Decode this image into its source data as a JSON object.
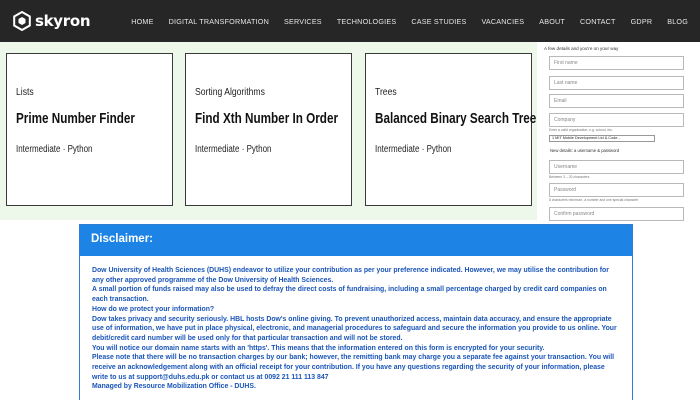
{
  "brand": {
    "name": "skyron",
    "logo_icon": "skyron-logo-icon"
  },
  "nav": {
    "items": [
      "HOME",
      "DIGITAL TRANSFORMATION",
      "SERVICES",
      "TECHNOLOGIES",
      "CASE STUDIES",
      "VACANCIES",
      "ABOUT",
      "CONTACT",
      "GDPR",
      "BLOG"
    ]
  },
  "cards": [
    {
      "category": "Lists",
      "title": "Prime Number Finder",
      "meta": "Intermediate · Python"
    },
    {
      "category": "Sorting Algorithms",
      "title": "Find Xth Number In Order",
      "meta": "Intermediate · Python"
    },
    {
      "category": "Trees",
      "title": "Balanced Binary Search Tree",
      "meta": "Intermediate · Python"
    }
  ],
  "form": {
    "heading": "A few details and you're on your way",
    "first_name_placeholder": "First name",
    "last_name_placeholder": "Last name",
    "email_placeholder": "Email",
    "company_placeholder": "Company",
    "company_hint": "Enter a valid organisation, e.g. school, etc.",
    "company_type_value": "1 MIT Mobile Development Ltd & Code...",
    "new_credentials_heading": "New details: a username & password",
    "username_placeholder": "Username",
    "username_hint": "Between 3 – 20 characters",
    "password_placeholder": "Password",
    "password_hint": "8 characters minimum, a number and one special character",
    "confirm_password_placeholder": "Confirm password"
  },
  "disclaimer": {
    "title": "Disclaimer:",
    "lines": [
      "Dow University of Health Sciences (DUHS) endeavor to utilize your contribution as per your preference indicated. However, we may utilise the contribution for any other approved programme of the Dow University of Health Sciences.",
      "A small portion of funds raised may also be used to defray the direct costs of fundraising, including a small percentage charged by credit card companies on each transaction.",
      "How do we protect your information?",
      "Dow takes privacy and security seriously. HBL hosts Dow's online giving. To prevent unauthorized access, maintain data accuracy, and ensure the appropriate use of information, we have put in place physical, electronic, and managerial procedures to safeguard and secure the information you provide to us online. Your debit/credit card number will be used only for that particular transaction and will not be stored.",
      "You will notice our domain name starts with an 'https'. This means that the information entered on this form is encrypted for your security.",
      "Please note that there will be no transaction charges by our bank; however, the remitting bank may charge you a separate fee against your transaction. You will receive an acknowledgement along with an official receipt for your contribution. If you have any questions regarding the security of your information, please write to us at support@duhs.edu.pk or contact us at 0092 21 111 113 847",
      "Managed by Resource Mobilization Office - DUHS."
    ]
  },
  "colors": {
    "nav_bg": "#262626",
    "cards_bg": "#edf7ea",
    "disclaimer_header": "#1d84e6",
    "disclaimer_text": "#1a55b8"
  }
}
